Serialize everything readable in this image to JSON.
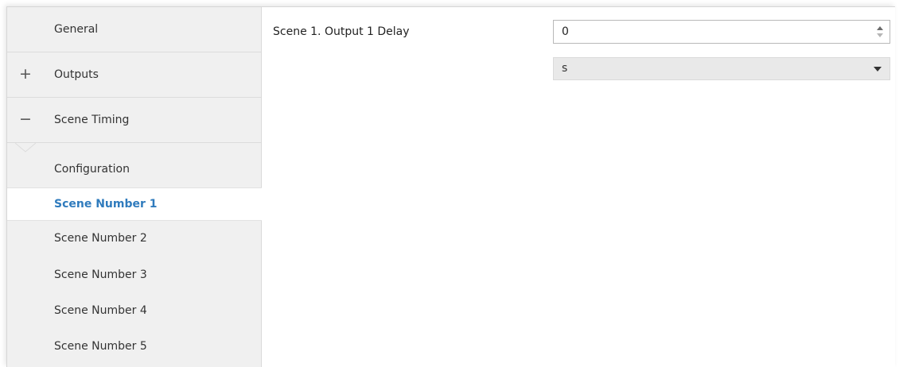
{
  "sidebar": {
    "general": {
      "label": "General"
    },
    "outputs": {
      "label": "Outputs",
      "sign": "+"
    },
    "scene_timing": {
      "label": "Scene Timing",
      "sign": "−"
    },
    "sub_items": [
      {
        "label": "Configuration",
        "selected": false
      },
      {
        "label": "Scene Number 1",
        "selected": true
      },
      {
        "label": "Scene Number 2",
        "selected": false
      },
      {
        "label": "Scene Number 3",
        "selected": false
      },
      {
        "label": "Scene Number 4",
        "selected": false
      },
      {
        "label": "Scene Number 5",
        "selected": false
      }
    ]
  },
  "main": {
    "param_label": "Scene 1. Output 1 Delay",
    "delay_value": "0",
    "unit_value": "s"
  },
  "icons": {
    "spin_up": "triangle-up-icon",
    "spin_down": "triangle-down-icon",
    "dropdown": "chevron-down-icon"
  },
  "colors": {
    "selected_text": "#2f7bbd",
    "sidebar_bg": "#f0f0f0",
    "select_bg": "#e9e9e9"
  }
}
